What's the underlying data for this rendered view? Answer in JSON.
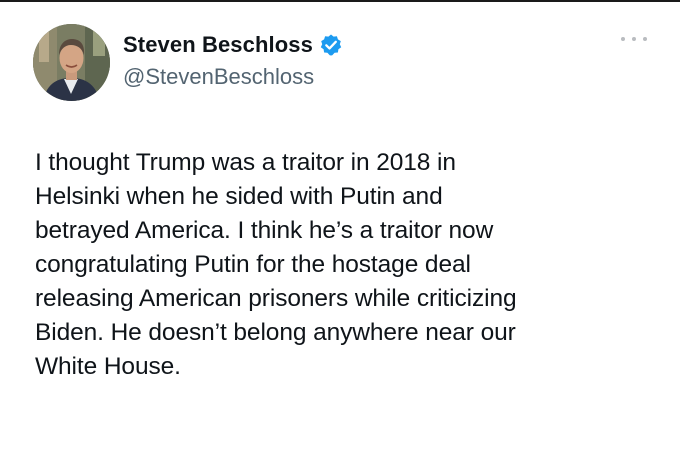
{
  "tweet": {
    "author": {
      "display_name": "Steven Beschloss",
      "handle": "@StevenBeschloss",
      "verified_icon": "verified-badge-icon",
      "verified_color": "#1d9bf0"
    },
    "more_icon": "more-options-icon",
    "text": "I thought Trump was a traitor in 2018 in\nHelsinki when he sided with Putin and\nbetrayed America. I think he’s a traitor now\ncongratulating Putin for the hostage deal\nreleasing American prisoners while criticizing\nBiden. He doesn’t belong anywhere near our\nWhite House."
  }
}
